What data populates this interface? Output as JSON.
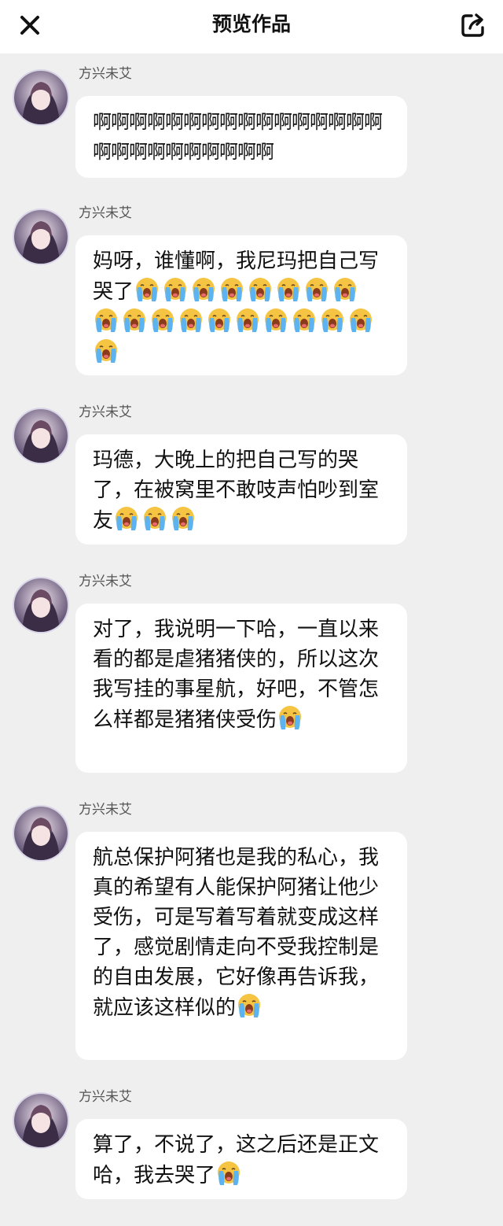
{
  "header": {
    "title": "预览作品",
    "close_icon": "close-icon",
    "share_icon": "share-icon"
  },
  "messages": [
    {
      "author": "方兴未艾",
      "text": "啊啊啊啊啊啊啊啊啊啊啊啊啊啊啊啊啊啊啊啊啊啊啊啊啊啊",
      "emoji_count": 0
    },
    {
      "author": "方兴未艾",
      "text": "妈呀，谁懂啊，我尼玛把自己写哭了",
      "emoji_count": 19
    },
    {
      "author": "方兴未艾",
      "text": "玛德，大晚上的把自己写的哭了，在被窝里不敢吱声怕吵到室友",
      "emoji_count": 3
    },
    {
      "author": "方兴未艾",
      "text": "对了，我说明一下哈，一直以来看的都是虐猪猪侠的，所以这次我写挂的事星航，好吧，不管怎么样都是猪猪侠受伤",
      "emoji_count": 1
    },
    {
      "author": "方兴未艾",
      "text": "航总保护阿猪也是我的私心，我真的希望有人能保护阿猪让他少受伤，可是写着写着就变成这样了，感觉剧情走向不受我控制是的自由发展，它好像再告诉我，就应该这样似的",
      "emoji_count": 1
    },
    {
      "author": "方兴未艾",
      "text": "算了，不说了，这之后还是正文哈，我去哭了",
      "emoji_count": 1
    }
  ],
  "emoji_name": "loudly-crying-face-icon",
  "colors": {
    "background": "#efefef",
    "bubble": "#ffffff",
    "emoji_face": "#f6c443",
    "emoji_tears": "#5db3f0"
  }
}
